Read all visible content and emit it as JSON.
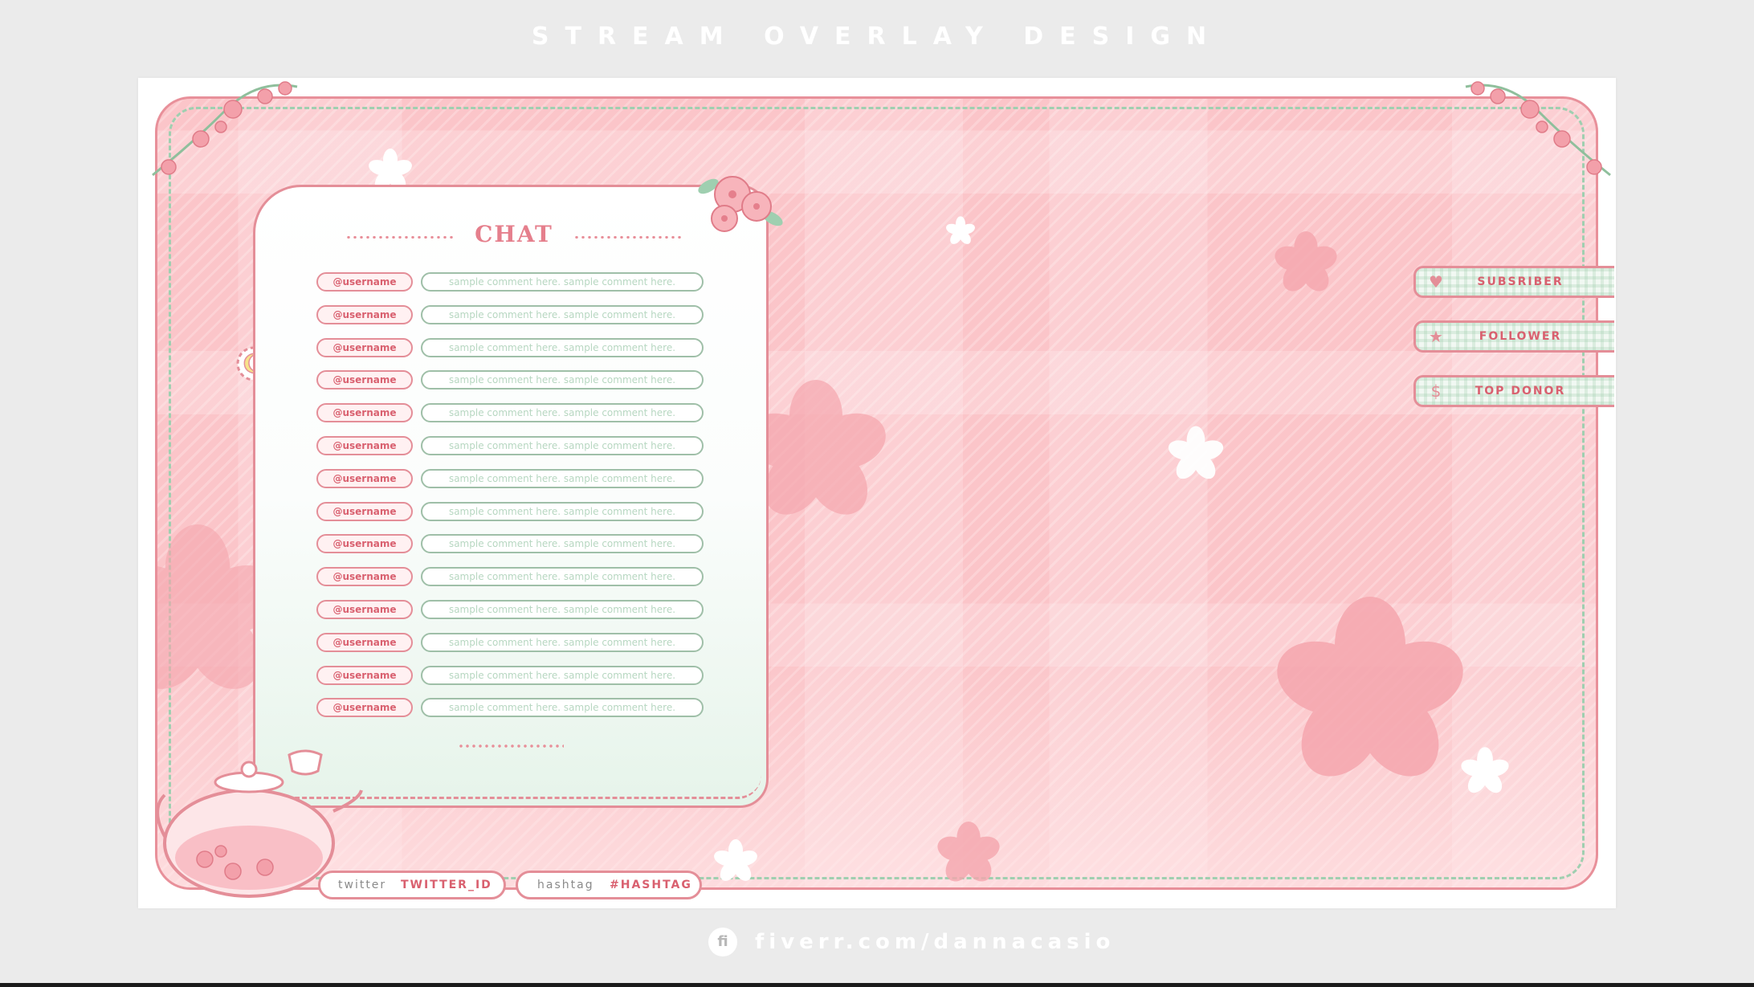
{
  "page_title": "STREAM OVERLAY DESIGN",
  "chat": {
    "title": "CHAT",
    "rows": [
      {
        "username": "@username",
        "comment": "sample comment here. sample comment here."
      },
      {
        "username": "@username",
        "comment": "sample comment here. sample comment here."
      },
      {
        "username": "@username",
        "comment": "sample comment here. sample comment here."
      },
      {
        "username": "@username",
        "comment": "sample comment here. sample comment here."
      },
      {
        "username": "@username",
        "comment": "sample comment here. sample comment here."
      },
      {
        "username": "@username",
        "comment": "sample comment here. sample comment here."
      },
      {
        "username": "@username",
        "comment": "sample comment here. sample comment here."
      },
      {
        "username": "@username",
        "comment": "sample comment here. sample comment here."
      },
      {
        "username": "@username",
        "comment": "sample comment here. sample comment here."
      },
      {
        "username": "@username",
        "comment": "sample comment here. sample comment here."
      },
      {
        "username": "@username",
        "comment": "sample comment here. sample comment here."
      },
      {
        "username": "@username",
        "comment": "sample comment here. sample comment here."
      },
      {
        "username": "@username",
        "comment": "sample comment here. sample comment here."
      },
      {
        "username": "@username",
        "comment": "sample comment here. sample comment here."
      }
    ]
  },
  "alerts": {
    "subscriber": {
      "label": "SUBSRIBER",
      "icon": "heart-icon"
    },
    "follower": {
      "label": "FOLLOWER",
      "icon": "star-icon"
    },
    "top_donor": {
      "label": "TOP DONOR",
      "icon": "dollar-icon"
    }
  },
  "socials": {
    "twitter_label": "twitter",
    "twitter_value": "TWITTER_ID",
    "hashtag_label": "hashtag",
    "hashtag_value": "#HASHTAG"
  },
  "footer": {
    "logo_glyph": "fi",
    "url": "fiverr.com/dannacasio"
  },
  "colors": {
    "frame_pink": "#fbc5c9",
    "outline_pink": "#e48e98",
    "mint": "#9fcfb0",
    "background": "#ebebeb"
  }
}
